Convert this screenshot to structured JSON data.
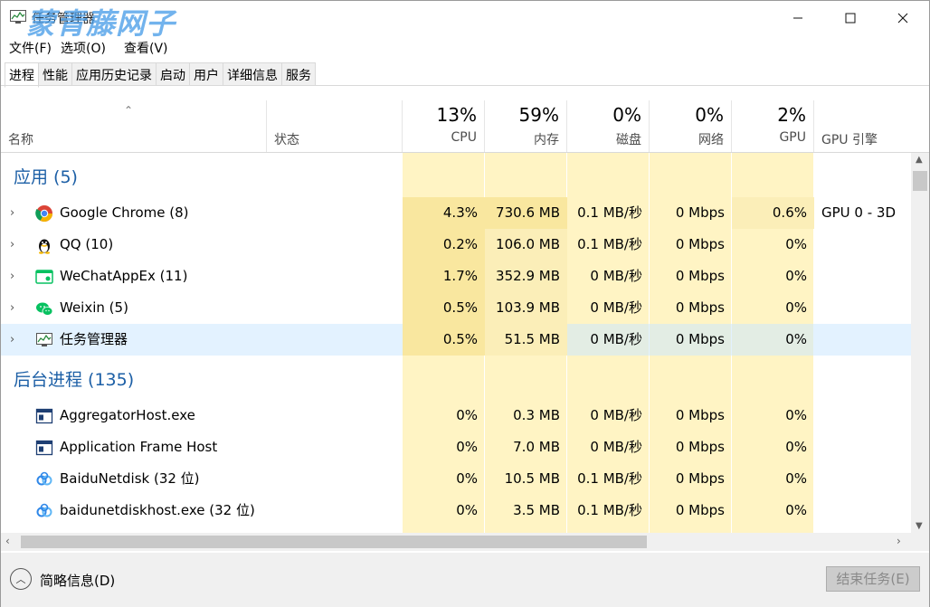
{
  "window": {
    "title": "任务管理器",
    "watermark": "蒙青藤网子",
    "controls": {
      "minimize_icon": "minimize-icon",
      "maximize_icon": "maximize-icon",
      "close_icon": "close-icon"
    }
  },
  "menu": [
    "文件(F)",
    "选项(O)",
    "查看(V)"
  ],
  "tabs": [
    "进程",
    "性能",
    "应用历史记录",
    "启动",
    "用户",
    "详细信息",
    "服务"
  ],
  "active_tab": "进程",
  "columns": {
    "name": "名称",
    "status": "状态",
    "cpu": {
      "pct": "13%",
      "label": "CPU"
    },
    "memory": {
      "pct": "59%",
      "label": "内存"
    },
    "disk": {
      "pct": "0%",
      "label": "磁盘"
    },
    "network": {
      "pct": "0%",
      "label": "网络"
    },
    "gpu": {
      "pct": "2%",
      "label": "GPU"
    },
    "gpu_engine": "GPU 引擎"
  },
  "groups": {
    "apps": "应用 (5)",
    "background": "后台进程 (135)"
  },
  "apps": [
    {
      "name": "Google Chrome (8)",
      "icon": "chrome-icon",
      "cpu": "4.3%",
      "memory": "730.6 MB",
      "disk": "0.1 MB/秒",
      "network": "0 Mbps",
      "gpu": "0.6%",
      "gpu_engine": "GPU 0 - 3D"
    },
    {
      "name": "QQ (10)",
      "icon": "qq-penguin-icon",
      "cpu": "0.2%",
      "memory": "106.0 MB",
      "disk": "0.1 MB/秒",
      "network": "0 Mbps",
      "gpu": "0%",
      "gpu_engine": ""
    },
    {
      "name": "WeChatAppEx (11)",
      "icon": "wechat-app-icon",
      "cpu": "1.7%",
      "memory": "352.9 MB",
      "disk": "0 MB/秒",
      "network": "0 Mbps",
      "gpu": "0%",
      "gpu_engine": ""
    },
    {
      "name": "Weixin (5)",
      "icon": "weixin-icon",
      "cpu": "0.5%",
      "memory": "103.9 MB",
      "disk": "0 MB/秒",
      "network": "0 Mbps",
      "gpu": "0%",
      "gpu_engine": ""
    },
    {
      "name": "任务管理器",
      "icon": "task-manager-icon",
      "cpu": "0.5%",
      "memory": "51.5 MB",
      "disk": "0 MB/秒",
      "network": "0 Mbps",
      "gpu": "0%",
      "gpu_engine": ""
    }
  ],
  "background": [
    {
      "name": "AggregatorHost.exe",
      "icon": "window-app-icon",
      "cpu": "0%",
      "memory": "0.3 MB",
      "disk": "0 MB/秒",
      "network": "0 Mbps",
      "gpu": "0%",
      "gpu_engine": ""
    },
    {
      "name": "Application Frame Host",
      "icon": "window-app-icon",
      "cpu": "0%",
      "memory": "7.0 MB",
      "disk": "0 MB/秒",
      "network": "0 Mbps",
      "gpu": "0%",
      "gpu_engine": ""
    },
    {
      "name": "BaiduNetdisk (32 位)",
      "icon": "baidu-netdisk-icon",
      "cpu": "0%",
      "memory": "10.5 MB",
      "disk": "0.1 MB/秒",
      "network": "0 Mbps",
      "gpu": "0%",
      "gpu_engine": ""
    },
    {
      "name": "baidunetdiskhost.exe (32 位)",
      "icon": "baidu-netdisk-icon",
      "cpu": "0%",
      "memory": "3.5 MB",
      "disk": "0.1 MB/秒",
      "network": "0 Mbps",
      "gpu": "0%",
      "gpu_engine": ""
    }
  ],
  "footer": {
    "fewer_details": "简略信息(D)",
    "end_task": "结束任务(E)"
  },
  "colors": {
    "heat_high": "#f9e79f",
    "heat_low": "#fff4c4",
    "group_title": "#1c5fa6",
    "selection": "#cce8ff"
  }
}
